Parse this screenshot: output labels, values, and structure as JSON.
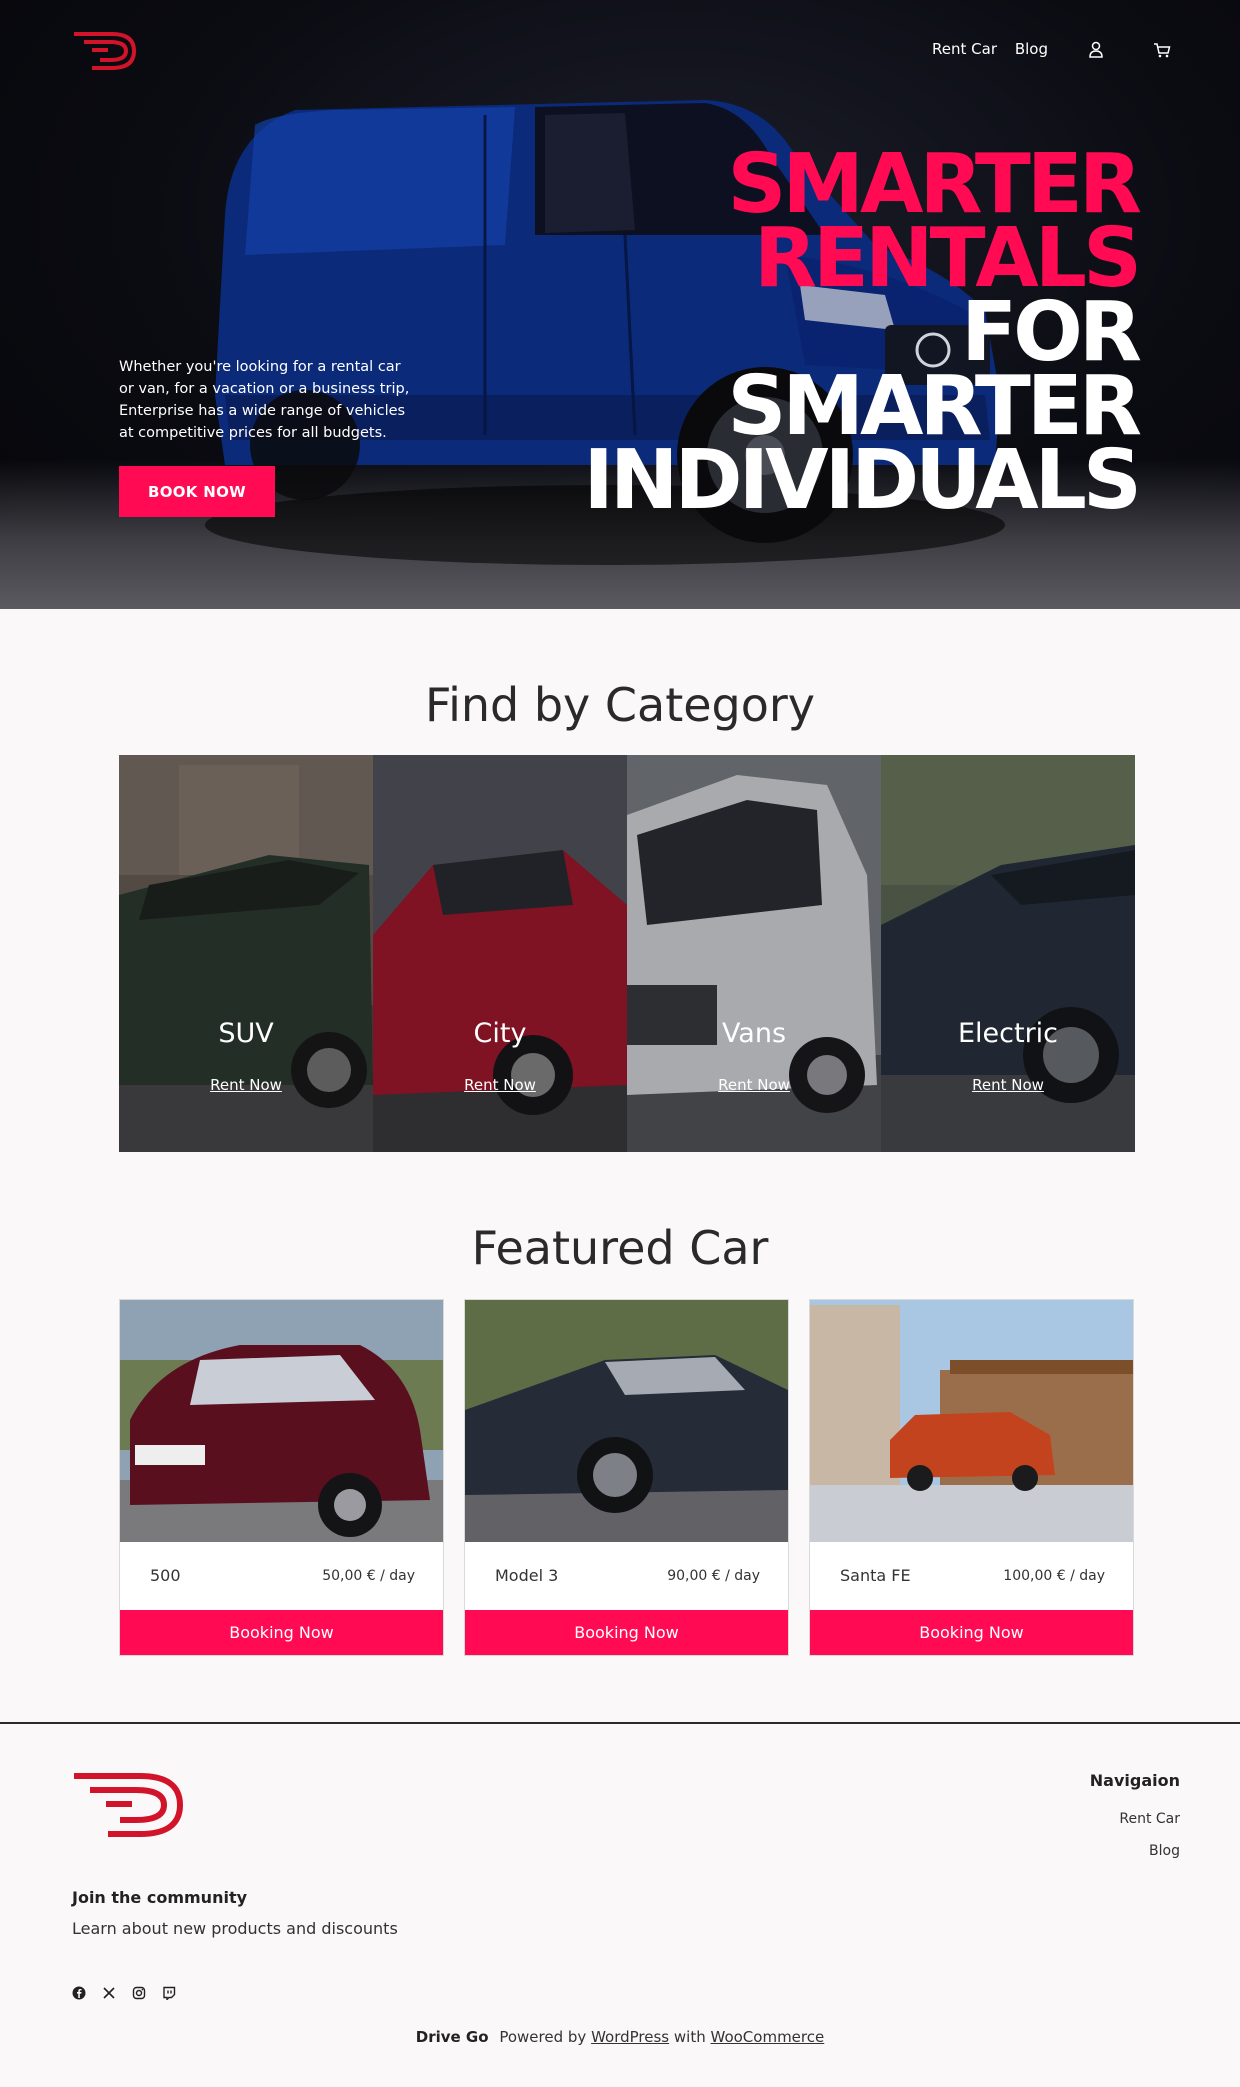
{
  "header": {
    "logo": "drive-go-logo",
    "nav": [
      {
        "label": "Rent Car"
      },
      {
        "label": "Blog"
      }
    ],
    "icons": [
      "user-icon",
      "cart-icon"
    ]
  },
  "hero": {
    "title_lines": [
      {
        "text": "SMARTER",
        "color": "pink"
      },
      {
        "text": "RENTALS",
        "color": "pink"
      },
      {
        "text": "FOR",
        "color": "white"
      },
      {
        "text": "SMARTER",
        "color": "white"
      },
      {
        "text": "INDIVIDUALS",
        "color": "white"
      }
    ],
    "description": "Whether you're looking for a rental car or van, for a vacation or a business trip, Enterprise has a wide range of vehicles at competitive prices for all budgets.",
    "cta": "BOOK NOW"
  },
  "categories": {
    "title": "Find by Category",
    "items": [
      {
        "name": "SUV",
        "link": "Rent Now"
      },
      {
        "name": "City",
        "link": "Rent Now"
      },
      {
        "name": "Vans",
        "link": "Rent Now"
      },
      {
        "name": "Electric",
        "link": "Rent Now"
      }
    ]
  },
  "featured": {
    "title": "Featured Car",
    "cars": [
      {
        "name": "500",
        "price": "50,00 € / day",
        "button": "Booking Now"
      },
      {
        "name": "Model 3",
        "price": "90,00 € / day",
        "button": "Booking Now"
      },
      {
        "name": "Santa FE",
        "price": "100,00 € / day",
        "button": "Booking Now"
      }
    ]
  },
  "footer": {
    "community_title": "Join the community",
    "community_text": "Learn about new products and discounts",
    "social": [
      "facebook-icon",
      "x-icon",
      "instagram-icon",
      "twitch-icon"
    ],
    "nav_title": "Navigaion",
    "nav_links": [
      "Rent Car",
      "Blog"
    ],
    "credit": {
      "brand": "Drive Go",
      "powered": "Powered by",
      "wordpress": "WordPress",
      "with": "with",
      "woocommerce": "WooCommerce"
    }
  },
  "colors": {
    "accent": "#ff0a53",
    "logo_red": "#d2142a",
    "hero_bg": "#0b0c12"
  }
}
